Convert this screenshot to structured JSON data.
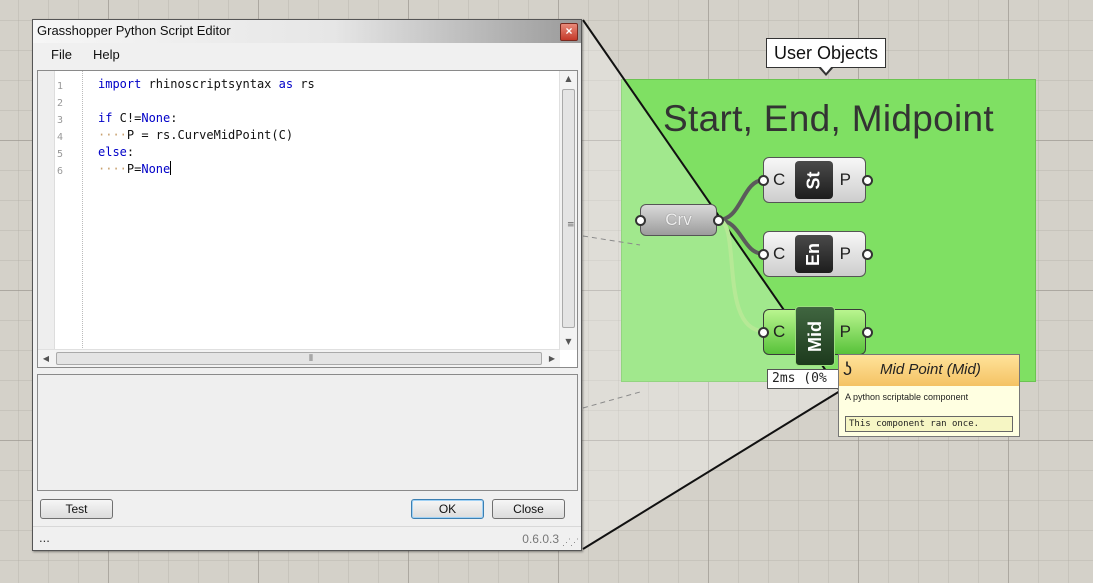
{
  "editor": {
    "title": "Grasshopper Python Script Editor",
    "close_glyph": "×",
    "menu": [
      "File",
      "Help"
    ],
    "line_numbers": [
      "1",
      "2",
      "3",
      "4",
      "5",
      "6"
    ],
    "code": {
      "l1_kw1": "import",
      "l1_mod": " rhinoscriptsyntax ",
      "l1_kw2": "as",
      "l1_alias": " rs",
      "l3_kw": "if",
      "l3_mid": " C!=",
      "l3_none": "None",
      "l3_end": ":",
      "l4_ws": "····",
      "l4_text": "P = rs.",
      "l4_call": "CurveMidPoint",
      "l4_end": "(C)",
      "l5_kw": "else",
      "l5_end": ":",
      "l6_ws": "····",
      "l6_text": "P=",
      "l6_none": "None"
    },
    "buttons": {
      "test": "Test",
      "ok": "OK",
      "close": "Close"
    },
    "status_left": "...",
    "version": "0.6.0.3",
    "scroll_glyphs": {
      "up": "▲",
      "down": "▼",
      "left": "◀",
      "right": "▶",
      "v_grip": "≡",
      "h_grip": "⦀",
      "resize": "⋰⋰"
    }
  },
  "canvas": {
    "group_title": "Start, End, Midpoint",
    "callout": "User Objects",
    "param": "Crv",
    "components": [
      {
        "input": "C",
        "nickname": "St",
        "output": "P"
      },
      {
        "input": "C",
        "nickname": "En",
        "output": "P"
      },
      {
        "input": "C",
        "nickname": "Mid",
        "output": "P"
      }
    ],
    "timing": "2ms (0%",
    "tooltip": {
      "icon": "ʖ",
      "title": "Mid Point (Mid)",
      "description": "A python scriptable component",
      "message": "This component ran once."
    }
  },
  "colors": {
    "group_fill": "#7fe063",
    "selected_component": "#58c23a",
    "keyword": "#0000c8",
    "whitespace_marker": "#c8a06e"
  }
}
